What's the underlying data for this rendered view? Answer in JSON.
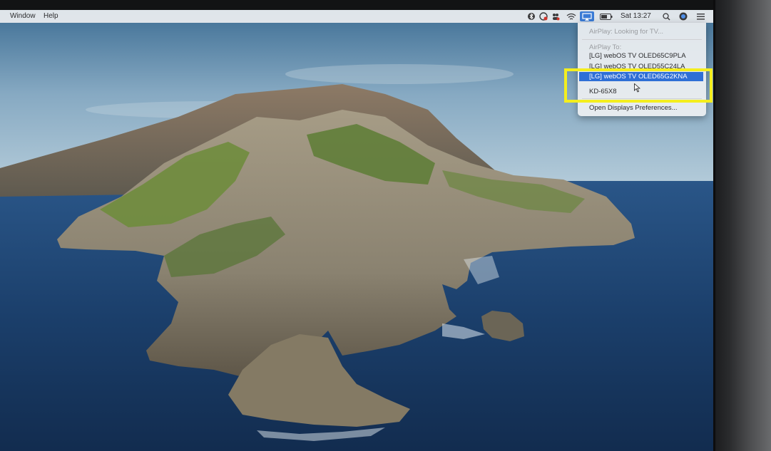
{
  "menubar": {
    "items": [
      "Window",
      "Help"
    ],
    "clock": "Sat 13:27"
  },
  "status_icons": [
    "bluetooth-icon",
    "sync-icon",
    "user-switch-icon",
    "wifi-icon",
    "airplay-icon",
    "battery-icon",
    "search-icon",
    "siri-icon",
    "menu-list-icon"
  ],
  "airplay_menu": {
    "status": "AirPlay: Looking for TV...",
    "airplay_to": "AirPlay To:",
    "devices": [
      "[LG] webOS TV OLED65C9PLA",
      "[LG] webOS TV OLED55C24LA",
      "[LG] webOS TV OLED65G2KNA",
      "KD-65X8"
    ],
    "selected_index": 2,
    "preferences": "Open Displays Preferences..."
  },
  "colors": {
    "highlight": "#f4ee1e",
    "selection": "#2f6fd6",
    "menubar": "#eceef0"
  }
}
